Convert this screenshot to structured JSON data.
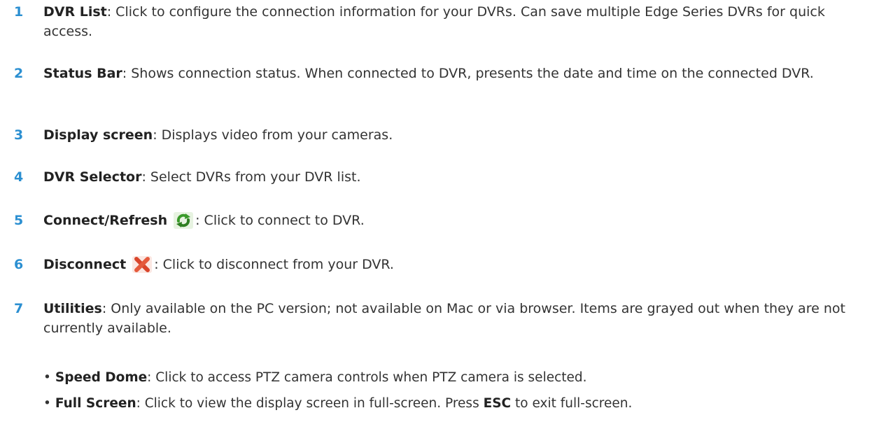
{
  "items": [
    {
      "num": "1",
      "term": "DVR List",
      "desc": ": Click to configure the connection information for your DVRs. Can save multiple Edge Series DVRs for quick access."
    },
    {
      "num": "2",
      "term": "Status Bar",
      "desc": ": Shows connection status. When connected to DVR, presents the date and time on the connected DVR."
    },
    {
      "num": "3",
      "term": "Display screen",
      "desc": ": Displays video from your cameras."
    },
    {
      "num": "4",
      "term": "DVR Selector",
      "desc": ": Select DVRs from your DVR list."
    },
    {
      "num": "5",
      "term": "Connect/Refresh",
      "icon": "refresh-icon",
      "desc": ": Click to connect to DVR."
    },
    {
      "num": "6",
      "term": "Disconnect",
      "icon": "disconnect-x-icon",
      "desc": ": Click to disconnect from your DVR."
    },
    {
      "num": "7",
      "term": "Utilities",
      "desc": ": Only available on the PC version; not available on Mac or via browser. Items are grayed out when they are not currently available.",
      "bullets": [
        {
          "dot": "•",
          "term": "Speed Dome",
          "desc": ": Click to access PTZ camera controls when PTZ camera is selected."
        },
        {
          "dot": "•",
          "term": "Full Screen",
          "desc_a": ": Click to view the display screen in full-screen. Press ",
          "key": "ESC",
          "desc_b": " to exit full-screen."
        }
      ]
    }
  ],
  "colors": {
    "number": "#2b8fd1",
    "text": "#333333",
    "refresh_icon": "#3a9a2a",
    "disconnect_icon": "#d9452b"
  }
}
